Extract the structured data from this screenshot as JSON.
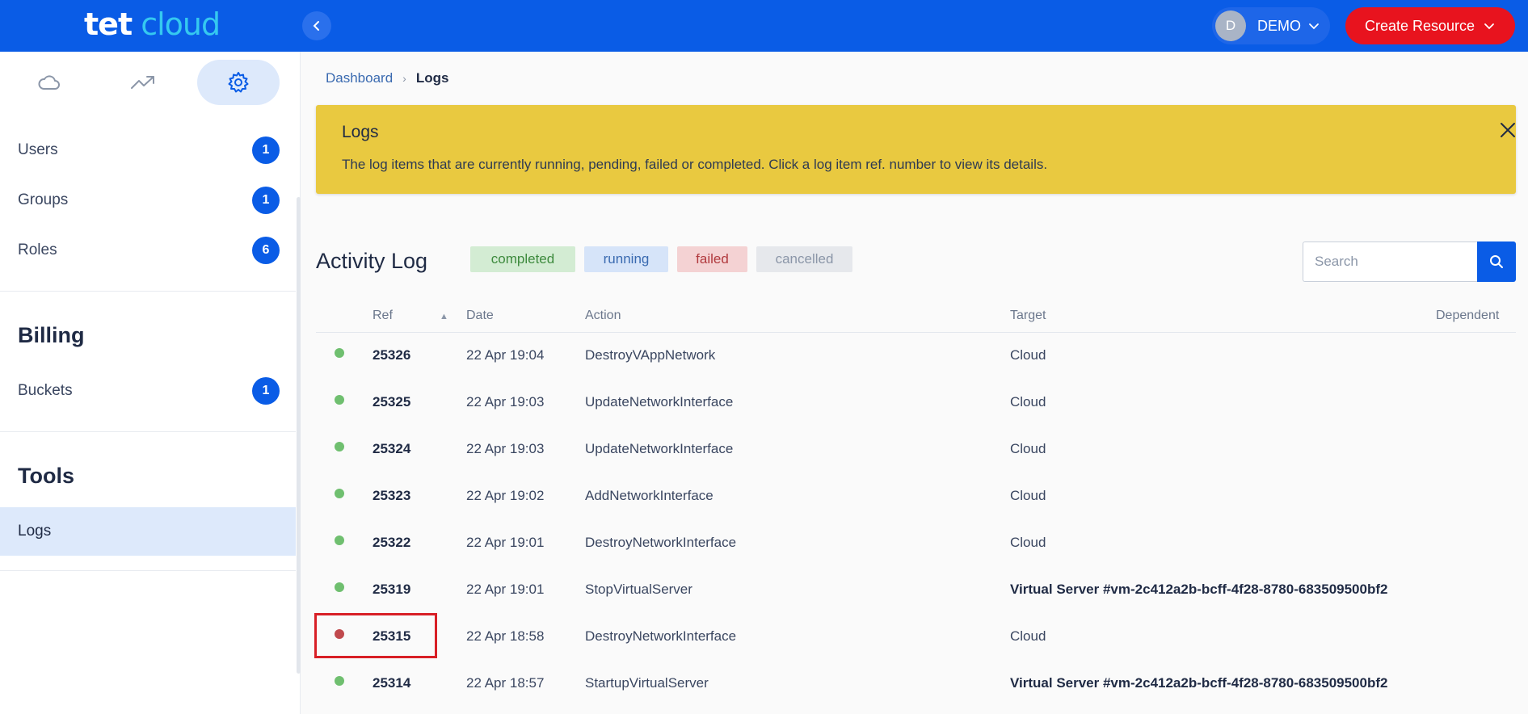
{
  "header": {
    "logo_left": "tet",
    "logo_right": "cloud",
    "user_initial": "D",
    "user_name": "DEMO",
    "create_label": "Create Resource"
  },
  "sidebar": {
    "items": [
      {
        "label": "Users",
        "count": "1"
      },
      {
        "label": "Groups",
        "count": "1"
      },
      {
        "label": "Roles",
        "count": "6"
      }
    ],
    "billing_heading": "Billing",
    "billing_items": [
      {
        "label": "Buckets",
        "count": "1"
      }
    ],
    "tools_heading": "Tools",
    "tools_items": [
      {
        "label": "Logs"
      }
    ]
  },
  "breadcrumb": {
    "home": "Dashboard",
    "current": "Logs"
  },
  "banner": {
    "title": "Logs",
    "text": "The log items that are currently running, pending, failed or completed. Click a log item ref. number to view its details."
  },
  "activity": {
    "title": "Activity Log",
    "filters": {
      "completed": "completed",
      "running": "running",
      "failed": "failed",
      "cancelled": "cancelled"
    },
    "search_placeholder": "Search"
  },
  "table": {
    "columns": {
      "ref": "Ref",
      "date": "Date",
      "action": "Action",
      "target": "Target",
      "dependent": "Dependent"
    },
    "rows": [
      {
        "status": "completed",
        "ref": "25326",
        "date": "22 Apr 19:04",
        "action": "DestroyVAppNetwork",
        "target": "Cloud"
      },
      {
        "status": "completed",
        "ref": "25325",
        "date": "22 Apr 19:03",
        "action": "UpdateNetworkInterface",
        "target": "Cloud"
      },
      {
        "status": "completed",
        "ref": "25324",
        "date": "22 Apr 19:03",
        "action": "UpdateNetworkInterface",
        "target": "Cloud"
      },
      {
        "status": "completed",
        "ref": "25323",
        "date": "22 Apr 19:02",
        "action": "AddNetworkInterface",
        "target": "Cloud"
      },
      {
        "status": "completed",
        "ref": "25322",
        "date": "22 Apr 19:01",
        "action": "DestroyNetworkInterface",
        "target": "Cloud"
      },
      {
        "status": "completed",
        "ref": "25319",
        "date": "22 Apr 19:01",
        "action": "StopVirtualServer",
        "target": "Virtual Server #vm-2c412a2b-bcff-4f28-8780-683509500bf2"
      },
      {
        "status": "failed",
        "ref": "25315",
        "date": "22 Apr 18:58",
        "action": "DestroyNetworkInterface",
        "target": "Cloud"
      },
      {
        "status": "completed",
        "ref": "25314",
        "date": "22 Apr 18:57",
        "action": "StartupVirtualServer",
        "target": "Virtual Server #vm-2c412a2b-bcff-4f28-8780-683509500bf2"
      }
    ]
  },
  "colors": {
    "brand": "#0a5ce6",
    "accent_red": "#e8131e",
    "status_completed": "#6fbf6f",
    "status_failed": "#c0494d",
    "banner": "#e9c940"
  }
}
